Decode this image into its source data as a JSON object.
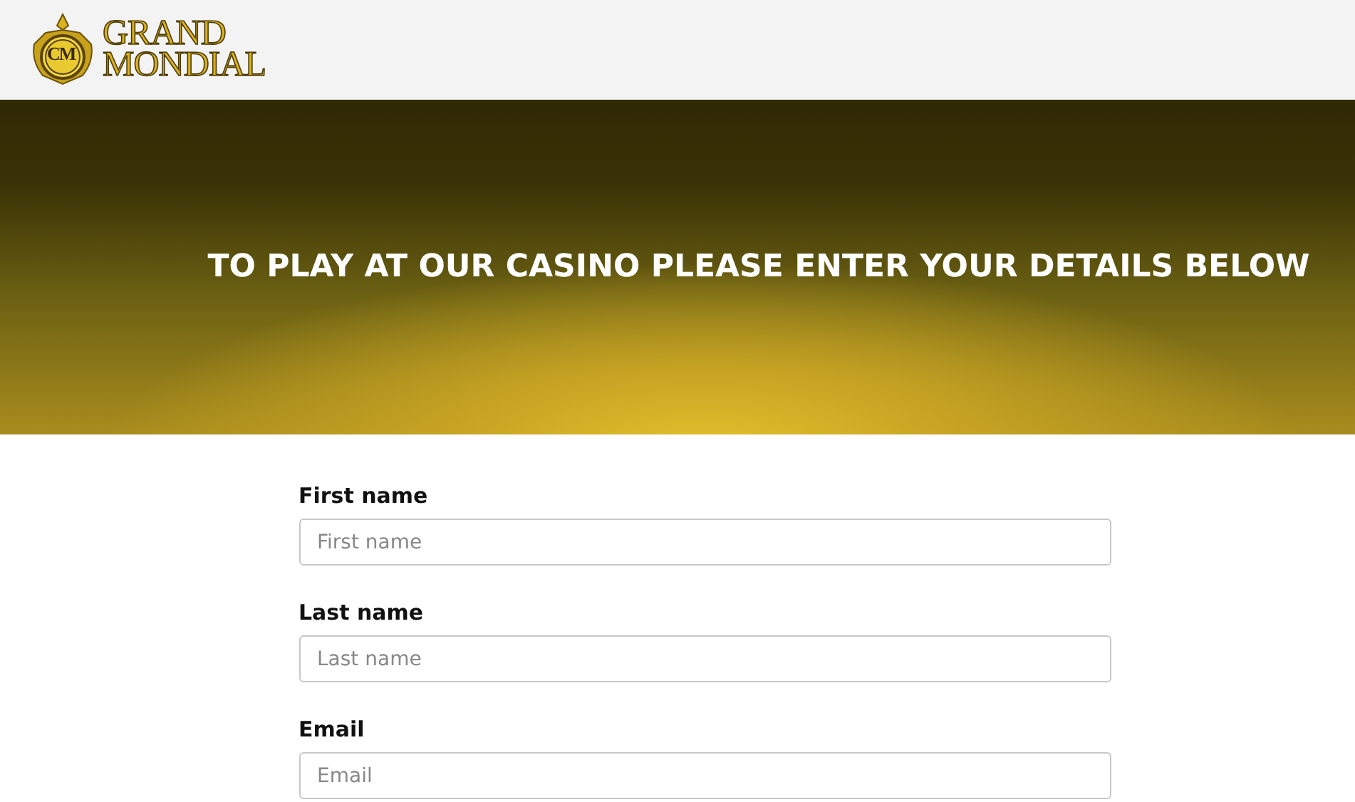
{
  "logo": {
    "monogram": "CM",
    "lines": [
      "GRAND",
      "MONDIAL"
    ]
  },
  "hero": {
    "title": "TO PLAY AT OUR CASINO PLEASE ENTER YOUR DETAILS BELOW"
  },
  "fields": [
    {
      "label": "First name",
      "placeholder": "First name"
    },
    {
      "label": "Last name",
      "placeholder": "Last name"
    },
    {
      "label": "Email",
      "placeholder": "Email"
    }
  ]
}
